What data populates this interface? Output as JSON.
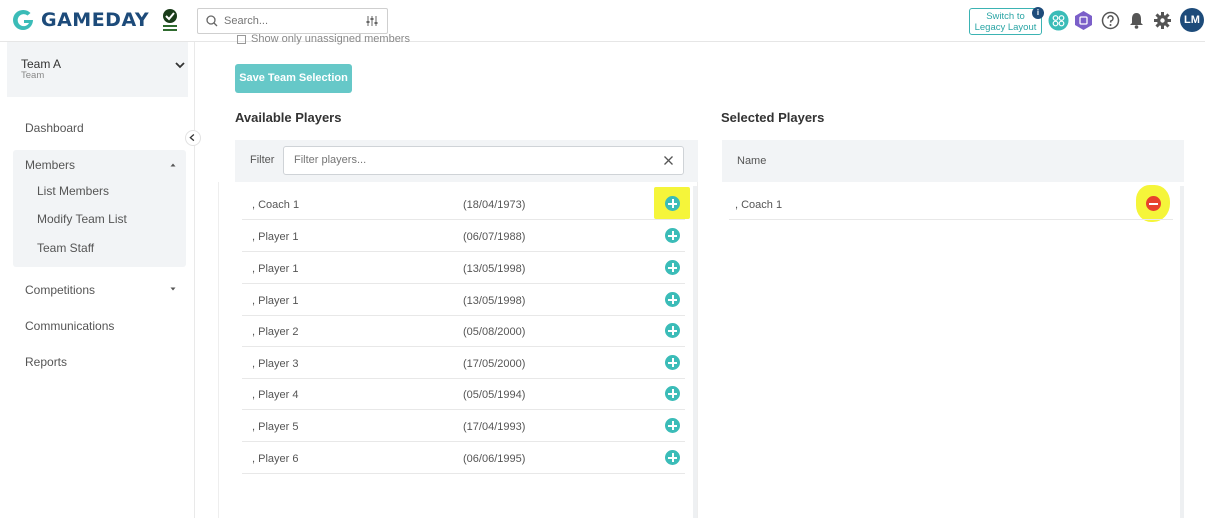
{
  "header": {
    "brand": "GAMEDAY",
    "search_placeholder": "Search...",
    "legacy_line1": "Switch to",
    "legacy_line2": "Legacy Layout",
    "legacy_badge": "i",
    "avatar_initials": "LM"
  },
  "sidebar": {
    "team_name": "Team A",
    "team_type": "Team",
    "items": [
      {
        "label": "Dashboard"
      },
      {
        "label": "Members"
      },
      {
        "label": "Competitions"
      },
      {
        "label": "Communications"
      },
      {
        "label": "Reports"
      }
    ],
    "members_sub": [
      {
        "label": "List Members"
      },
      {
        "label": "Modify Team List"
      },
      {
        "label": "Team Staff"
      }
    ]
  },
  "main": {
    "checkbox_label": "Show only unassigned members",
    "save_label": "Save Team Selection",
    "available_title": "Available Players",
    "selected_title": "Selected Players",
    "filter_label": "Filter",
    "filter_placeholder": "Filter players...",
    "selected_column": "Name",
    "available_players": [
      {
        "name": ", Coach 1",
        "dob": "(18/04/1973)"
      },
      {
        "name": ", Player 1",
        "dob": "(06/07/1988)"
      },
      {
        "name": ", Player 1",
        "dob": "(13/05/1998)"
      },
      {
        "name": ", Player 1",
        "dob": "(13/05/1998)"
      },
      {
        "name": ", Player 2",
        "dob": "(05/08/2000)"
      },
      {
        "name": ", Player 3",
        "dob": "(17/05/2000)"
      },
      {
        "name": ", Player 4",
        "dob": "(05/05/1994)"
      },
      {
        "name": ", Player 5",
        "dob": "(17/04/1993)"
      },
      {
        "name": ", Player 6",
        "dob": "(06/06/1995)"
      }
    ],
    "selected_players": [
      {
        "name": ", Coach 1"
      }
    ]
  },
  "colors": {
    "brand": "#1d4b7a",
    "accent": "#3bbcb8",
    "remove": "#e8412c",
    "highlight": "#f5f53a"
  }
}
